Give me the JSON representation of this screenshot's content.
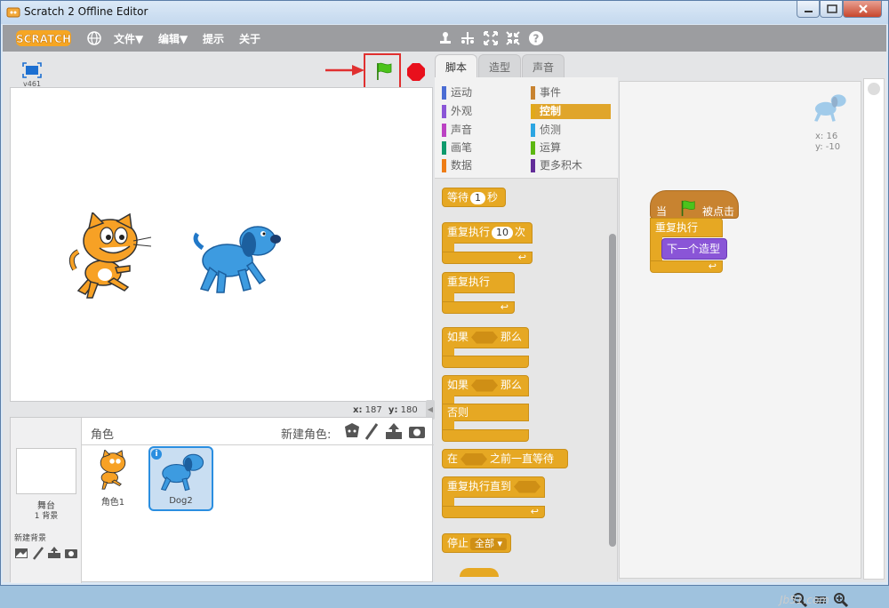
{
  "window": {
    "title": "Scratch 2 Offline Editor"
  },
  "menubar": {
    "logo": "SCRATCH",
    "items": [
      "文件▼",
      "编辑▼",
      "提示",
      "关于"
    ]
  },
  "stage": {
    "version": "v461",
    "coord_x_label": "x:",
    "coord_x": "187",
    "coord_y_label": "y:",
    "coord_y": "180"
  },
  "sprites_panel": {
    "title": "角色",
    "new_sprite_label": "新建角色:",
    "stage_label": "舞台",
    "backdrop_count": "1 背景",
    "new_backdrop_label": "新建背景",
    "sprites": [
      {
        "name": "角色1"
      },
      {
        "name": "Dog2"
      }
    ]
  },
  "tabs": [
    "脚本",
    "造型",
    "声音"
  ],
  "categories": [
    {
      "label": "运动",
      "color": "#4a6cd4"
    },
    {
      "label": "外观",
      "color": "#8a55d7"
    },
    {
      "label": "声音",
      "color": "#bb42c3"
    },
    {
      "label": "画笔",
      "color": "#0e9a6c"
    },
    {
      "label": "数据",
      "color": "#ee7d16"
    },
    {
      "label": "事件",
      "color": "#c88330"
    },
    {
      "label": "控制",
      "color": "#e1a91a"
    },
    {
      "label": "侦测",
      "color": "#2ca5e2"
    },
    {
      "label": "运算",
      "color": "#5cb712"
    },
    {
      "label": "更多积木",
      "color": "#632d99"
    }
  ],
  "blocks": {
    "wait": {
      "pre": "等待",
      "value": "1",
      "post": "秒"
    },
    "repeat": {
      "pre": "重复执行",
      "value": "10",
      "post": "次"
    },
    "forever": "重复执行",
    "if_then": {
      "pre": "如果",
      "post": "那么"
    },
    "if_else": {
      "pre": "如果",
      "post": "那么",
      "else": "否则"
    },
    "wait_until": {
      "pre": "在",
      "post": "之前一直等待"
    },
    "repeat_until": "重复执行直到",
    "stop": {
      "pre": "停止",
      "value": "全部"
    }
  },
  "script": {
    "hat_pre": "当",
    "hat_post": "被点击",
    "forever": "重复执行",
    "next_costume": "下一个造型"
  },
  "sprite_info": {
    "x_label": "x:",
    "x": "16",
    "y_label": "y:",
    "y": "-10"
  },
  "watermark": "Jb51.com"
}
